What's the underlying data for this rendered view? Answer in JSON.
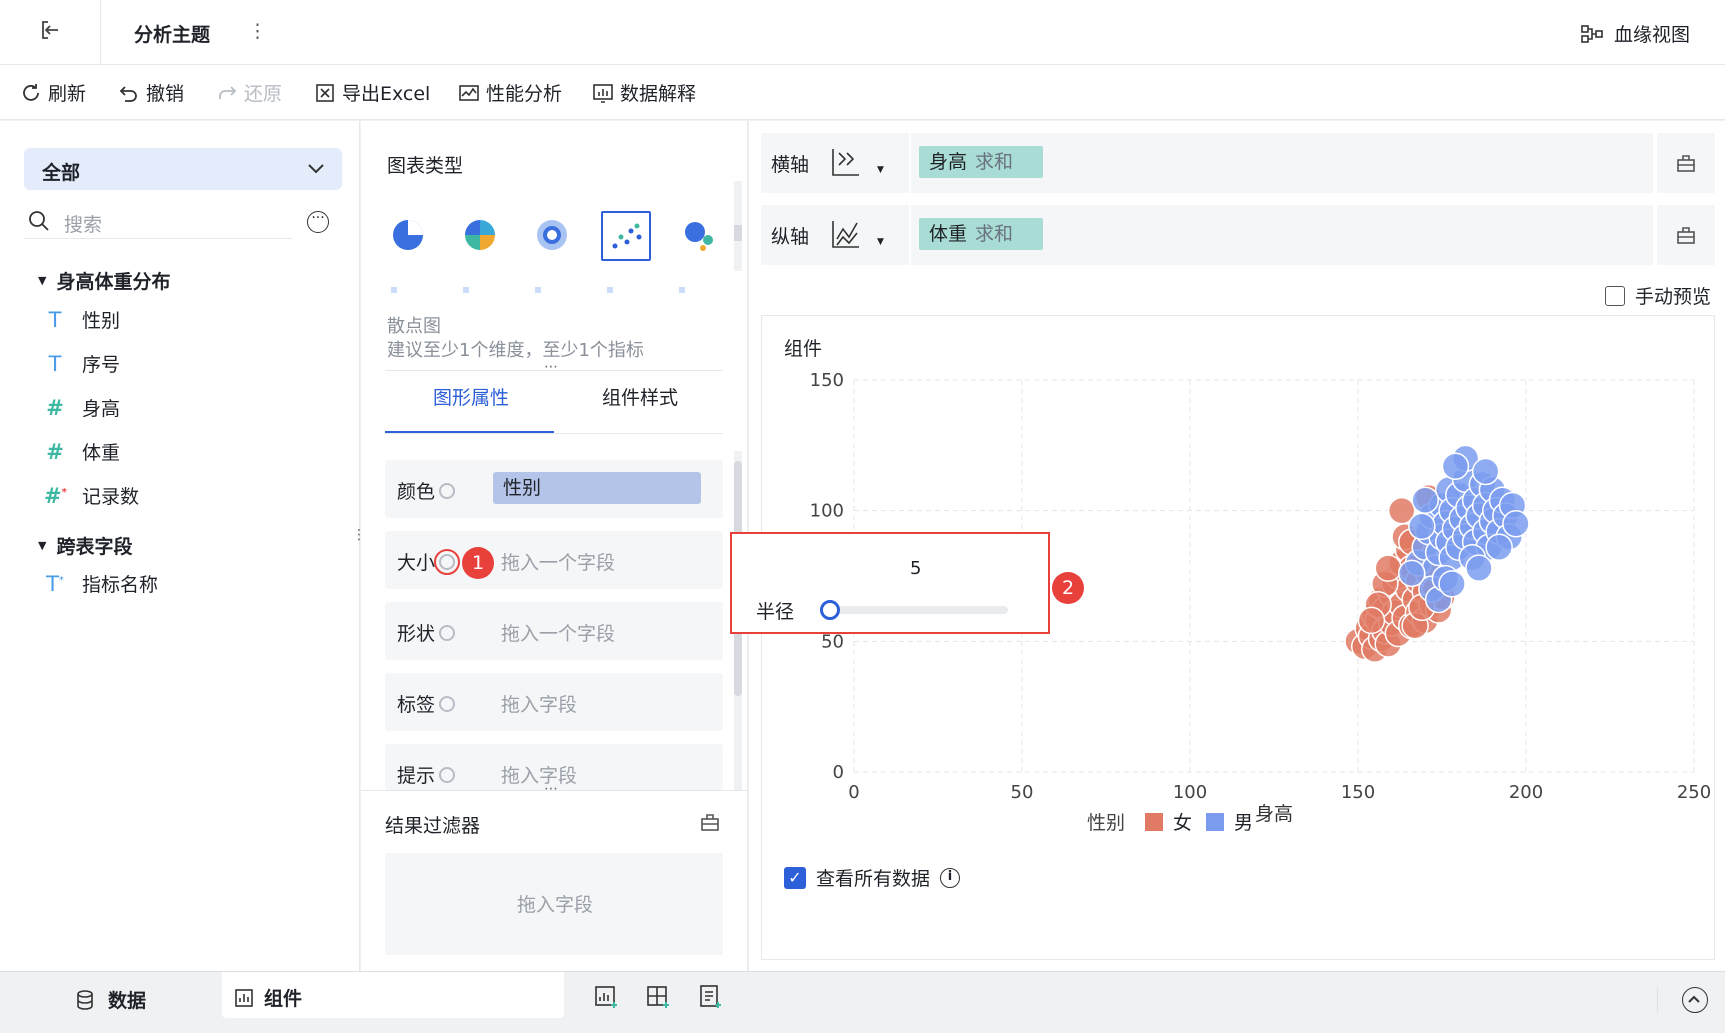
{
  "topbar": {
    "title": "分析主题",
    "more": "⋮",
    "lineage": "血缘视图"
  },
  "toolbar": {
    "refresh": "刷新",
    "undo": "撤销",
    "redo": "还原",
    "export": "导出Excel",
    "perf": "性能分析",
    "explain": "数据解释"
  },
  "left": {
    "dropdown": "全部",
    "search_placeholder": "搜索",
    "group1": "身高体重分布",
    "fields1": [
      {
        "icon": "T",
        "label": "性别"
      },
      {
        "icon": "T",
        "label": "序号"
      },
      {
        "icon": "#",
        "label": "身高"
      },
      {
        "icon": "#",
        "label": "体重"
      },
      {
        "icon": "#*",
        "label": "记录数"
      }
    ],
    "group2": "跨表字段",
    "fields2": [
      {
        "icon": "T*",
        "label": "指标名称"
      }
    ]
  },
  "mid": {
    "chart_types_title": "图表类型",
    "chart_name": "散点图",
    "chart_hint": "建议至少1个维度，至少1个指标",
    "tabs": [
      "图形属性",
      "组件样式"
    ],
    "props": [
      {
        "label": "颜色",
        "value": "性别"
      },
      {
        "label": "大小",
        "value": "拖入一个字段"
      },
      {
        "label": "形状",
        "value": "拖入一个字段"
      },
      {
        "label": "标签",
        "value": "拖入字段"
      },
      {
        "label": "提示",
        "value": "拖入字段"
      }
    ],
    "filter_title": "结果过滤器",
    "filter_drop": "拖入字段"
  },
  "popup": {
    "value": "5",
    "label": "半径",
    "badge1": "1",
    "badge2": "2",
    "slider_fraction": 0.0
  },
  "right": {
    "x_axis_label": "横轴",
    "y_axis_label": "纵轴",
    "x_pill": "身高",
    "x_agg": "求和",
    "y_pill": "体重",
    "y_agg": "求和",
    "manual_preview": "手动预览",
    "component_title": "组件",
    "view_all": "查看所有数据"
  },
  "bottom": {
    "data_tab": "数据",
    "component_tab": "组件"
  },
  "chart_data": {
    "type": "scatter",
    "xlabel": "身高",
    "ylabel": "",
    "xlim": [
      0,
      250
    ],
    "ylim": [
      0,
      150
    ],
    "xticks": [
      "0",
      "50",
      "100",
      "150",
      "200",
      "250"
    ],
    "yticks": [
      "0",
      "50",
      "100",
      "150"
    ],
    "legend_title": "性别",
    "grid": true,
    "legend_position": "bottom",
    "series": [
      {
        "name": "女",
        "color": "#e07a64",
        "points": [
          [
            150,
            50
          ],
          [
            152,
            48
          ],
          [
            153,
            55
          ],
          [
            154,
            52
          ],
          [
            155,
            47
          ],
          [
            155,
            60
          ],
          [
            156,
            58
          ],
          [
            157,
            51
          ],
          [
            157,
            66
          ],
          [
            158,
            62
          ],
          [
            158,
            54
          ],
          [
            159,
            49
          ],
          [
            160,
            68
          ],
          [
            160,
            57
          ],
          [
            161,
            72
          ],
          [
            161,
            61
          ],
          [
            162,
            53
          ],
          [
            162,
            75
          ],
          [
            163,
            64
          ],
          [
            163,
            80
          ],
          [
            164,
            59
          ],
          [
            165,
            70
          ],
          [
            165,
            85
          ],
          [
            166,
            56
          ],
          [
            166,
            78
          ],
          [
            167,
            66
          ],
          [
            168,
            73
          ],
          [
            168,
            61
          ],
          [
            169,
            82
          ],
          [
            170,
            69
          ],
          [
            170,
            58
          ],
          [
            171,
            76
          ],
          [
            172,
            64
          ],
          [
            163,
            100
          ],
          [
            171,
            105
          ],
          [
            158,
            72
          ],
          [
            156,
            64
          ],
          [
            164,
            90
          ],
          [
            167,
            56
          ],
          [
            173,
            70
          ],
          [
            174,
            62
          ],
          [
            175,
            67
          ],
          [
            154,
            58
          ],
          [
            159,
            78
          ],
          [
            166,
            88
          ],
          [
            169,
            63
          ]
        ]
      },
      {
        "name": "男",
        "color": "#7b9cee",
        "points": [
          [
            168,
            80
          ],
          [
            170,
            86
          ],
          [
            171,
            92
          ],
          [
            172,
            98
          ],
          [
            173,
            78
          ],
          [
            174,
            84
          ],
          [
            175,
            90
          ],
          [
            175,
            102
          ],
          [
            176,
            95
          ],
          [
            177,
            88
          ],
          [
            177,
            108
          ],
          [
            178,
            82
          ],
          [
            178,
            100
          ],
          [
            179,
            93
          ],
          [
            180,
            86
          ],
          [
            180,
            106
          ],
          [
            181,
            97
          ],
          [
            182,
            90
          ],
          [
            182,
            112
          ],
          [
            183,
            101
          ],
          [
            184,
            94
          ],
          [
            185,
            104
          ],
          [
            185,
            88
          ],
          [
            186,
            98
          ],
          [
            187,
            110
          ],
          [
            188,
            92
          ],
          [
            188,
            102
          ],
          [
            189,
            86
          ],
          [
            190,
            96
          ],
          [
            190,
            108
          ],
          [
            191,
            100
          ],
          [
            192,
            92
          ],
          [
            193,
            104
          ],
          [
            194,
            98
          ],
          [
            195,
            90
          ],
          [
            196,
            102
          ],
          [
            182,
            120
          ],
          [
            188,
            115
          ],
          [
            172,
            70
          ],
          [
            174,
            66
          ],
          [
            176,
            74
          ],
          [
            178,
            72
          ],
          [
            166,
            76
          ],
          [
            169,
            94
          ],
          [
            184,
            82
          ],
          [
            186,
            78
          ],
          [
            192,
            86
          ],
          [
            197,
            95
          ],
          [
            179,
            117
          ],
          [
            170,
            104
          ]
        ]
      }
    ]
  }
}
